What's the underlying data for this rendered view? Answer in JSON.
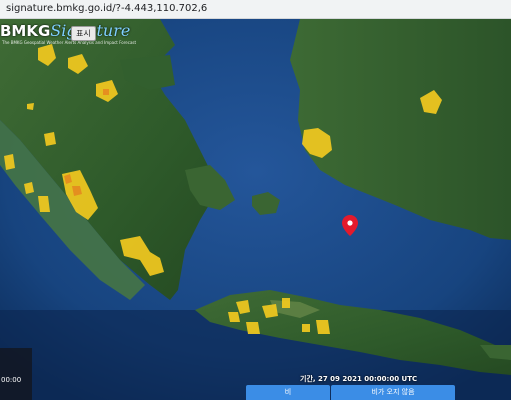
{
  "browser": {
    "url": "signature.bmkg.go.id/?-4.443,110.702,6"
  },
  "brand": {
    "bmkg": "BMKG",
    "signature": "Signature",
    "tagline": "The BMKG Geospatial Weather Alerts Analysis and Impact Forecast"
  },
  "controls": {
    "show_label": "표시",
    "time_prefix": "00:00",
    "date_text": "기간, 27 09 2021 00:00:00 UTC"
  },
  "tabs": [
    {
      "label": "비"
    },
    {
      "label": "비가 오지 않음"
    }
  ],
  "map": {
    "marker_icon": "map-pin-icon",
    "marker_color": "#e41a2c",
    "warning_area_color": "#f2c91f",
    "severe_area_color": "#e58a1f"
  }
}
